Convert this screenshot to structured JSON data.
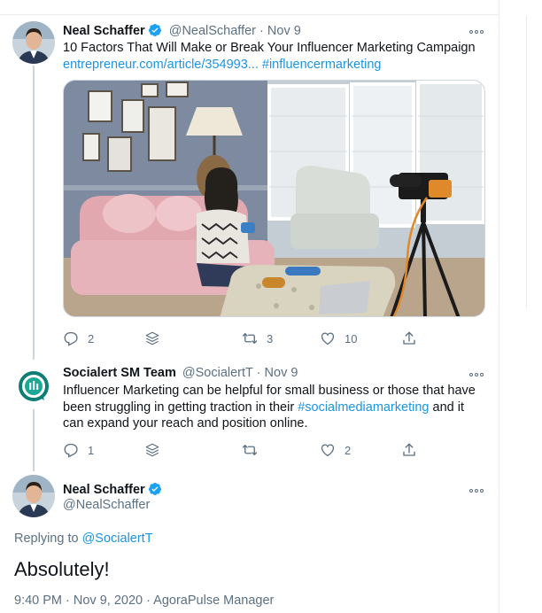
{
  "tweets": [
    {
      "name": "Neal Schaffer",
      "handle": "@NealSchaffer",
      "separator": "·",
      "date": "Nov 9",
      "text": "10 Factors That Will Make or Break Your Influencer Marketing Campaign",
      "link": "entrepreneur.com/article/354993...",
      "hashtag": "#influencermarketing",
      "replies": "2",
      "retweets": "3",
      "likes": "10"
    },
    {
      "name": "Socialert SM Team",
      "handle": "@SocialertT",
      "separator": "·",
      "date": "Nov 9",
      "text_before": "Influencer Marketing can be helpful for small business or those that have been struggling in getting traction in their ",
      "hashtag": "#socialmediamarketing",
      "text_after": " and it can expand your reach and position online.",
      "replies": "1",
      "retweets": "",
      "likes": "2"
    }
  ],
  "focused": {
    "name": "Neal Schaffer",
    "handle": "@NealSchaffer",
    "replying_label": "Replying to",
    "replying_handle": "@SocialertT",
    "text": "Absolutely!",
    "meta": "9:40 PM · Nov 9, 2020 · AgoraPulse Manager"
  },
  "colors": {
    "accent": "#1b95e0",
    "muted": "#5b7083",
    "verified": "#1da1f2"
  },
  "icons": [
    "verified-badge-icon",
    "more-icon",
    "reply-icon",
    "analytics-icon",
    "retweet-icon",
    "like-icon",
    "share-icon"
  ]
}
